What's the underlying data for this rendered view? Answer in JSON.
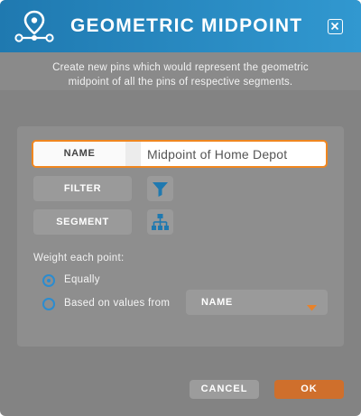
{
  "header": {
    "title": "GEOMETRIC MIDPOINT",
    "icon": "midpoint-pin-icon",
    "close_icon": "close-icon"
  },
  "description": {
    "line1": "Create new pins which would represent the geometric",
    "line2": "midpoint of all the pins of respective segments."
  },
  "form": {
    "name_label": "NAME",
    "name_value": "Midpoint of Home Depot",
    "filter_label": "FILTER",
    "filter_icon": "filter-funnel-icon",
    "segment_label": "SEGMENT",
    "segment_icon": "hierarchy-icon",
    "weight_label": "Weight each point:",
    "options": [
      {
        "label": "Equally",
        "selected": true
      },
      {
        "label": "Based on values from",
        "selected": false
      }
    ],
    "values_select": {
      "value": "NAME",
      "icon": "dropdown-arrow-icon"
    }
  },
  "footer": {
    "cancel_label": "CANCEL",
    "ok_label": "OK"
  },
  "colors": {
    "header_start": "#1f79b0",
    "header_end": "#3198d0",
    "accent_orange": "#f0861f",
    "ok_button": "#cf6f2c",
    "radio_blue": "#2b8cd0",
    "icon_blue": "#1f79b0"
  }
}
